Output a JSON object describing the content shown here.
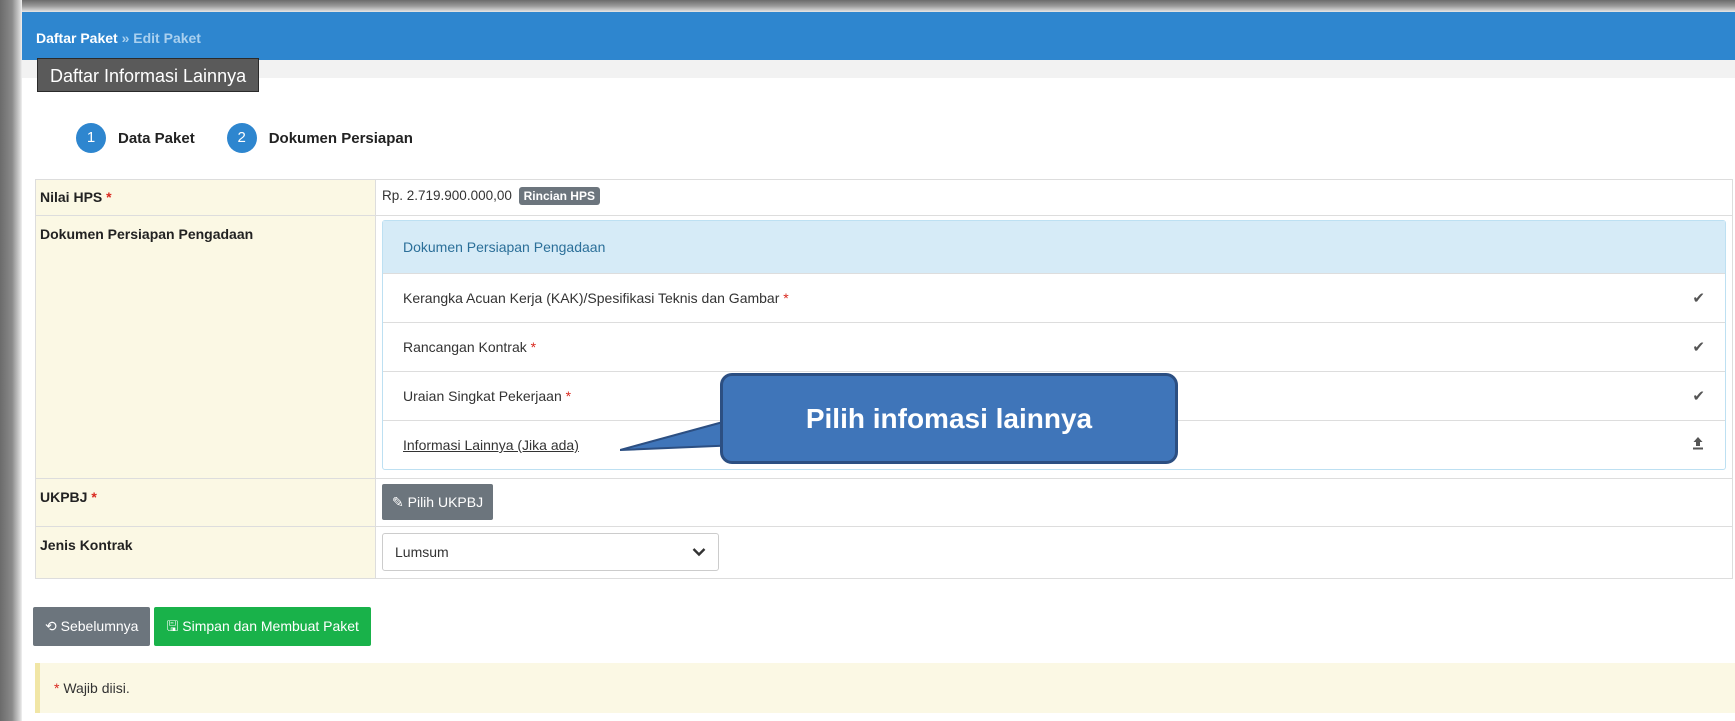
{
  "breadcrumb": {
    "parent": "Daftar Paket",
    "separator": "»",
    "current": "Edit Paket"
  },
  "tooltip": "Daftar Informasi Lainnya",
  "steps": [
    {
      "num": "1",
      "label": "Data Paket"
    },
    {
      "num": "2",
      "label": "Dokumen Persiapan"
    }
  ],
  "form": {
    "required_mark": "*",
    "nilai_hps": {
      "label": "Nilai HPS",
      "value": "Rp. 2.719.900.000,00",
      "button": "Rincian HPS"
    },
    "dokumen": {
      "label": "Dokumen Persiapan Pengadaan",
      "panel_title": "Dokumen Persiapan Pengadaan",
      "items": [
        {
          "label": "Kerangka Acuan Kerja (KAK)/Spesifikasi Teknis dan Gambar",
          "required": true,
          "icon": "check-icon"
        },
        {
          "label": "Rancangan Kontrak",
          "required": true,
          "icon": "check-icon"
        },
        {
          "label": "Uraian Singkat Pekerjaan",
          "required": true,
          "icon": "check-icon"
        },
        {
          "label": "Informasi Lainnya (Jika ada)",
          "required": false,
          "icon": "upload-icon"
        }
      ]
    },
    "ukpbj": {
      "label": "UKPBJ",
      "button": "Pilih UKPBJ"
    },
    "jenis_kontrak": {
      "label": "Jenis Kontrak",
      "value": "Lumsum"
    }
  },
  "actions": {
    "back": "Sebelumnya",
    "save": "Simpan dan Membuat Paket"
  },
  "note": {
    "mark": "*",
    "text": "Wajib diisi."
  },
  "callout": "Pilih infomasi lainnya",
  "colors": {
    "header": "#2e86cf",
    "callout": "#3f75b9",
    "save": "#19b24a",
    "required": "#d9281e"
  }
}
